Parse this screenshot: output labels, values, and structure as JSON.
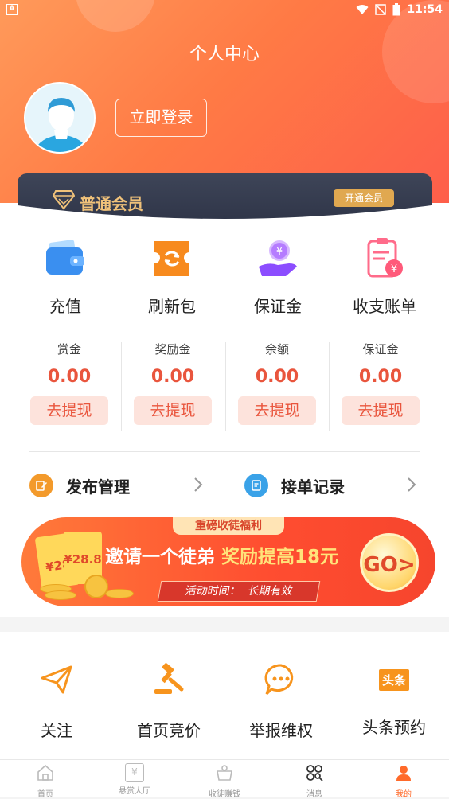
{
  "status_bar": {
    "time": "11:54",
    "app_badge": "A"
  },
  "header": {
    "title": "个人中心",
    "login_label": "立即登录"
  },
  "vip": {
    "level": "普通会员",
    "open_label": "开通会员"
  },
  "quick_actions": [
    {
      "label": "充值",
      "icon": "wallet-icon"
    },
    {
      "label": "刷新包",
      "icon": "refresh-ticket-icon"
    },
    {
      "label": "保证金",
      "icon": "deposit-hand-icon"
    },
    {
      "label": "收支账单",
      "icon": "bill-icon"
    }
  ],
  "balances": [
    {
      "title": "赏金",
      "value": "0.00",
      "action": "去提现"
    },
    {
      "title": "奖励金",
      "value": "0.00",
      "action": "去提现"
    },
    {
      "title": "余额",
      "value": "0.00",
      "action": "去提现"
    },
    {
      "title": "保证金",
      "value": "0.00",
      "action": "去提现"
    }
  ],
  "management": [
    {
      "label": "发布管理",
      "icon": "edit-icon",
      "color": "#f39a2b"
    },
    {
      "label": "接单记录",
      "icon": "record-icon",
      "color": "#3aa2e8"
    }
  ],
  "banner": {
    "tag": "重磅收徒福利",
    "text_prefix": "邀请一个徒弟 ",
    "text_highlight": "奖励提高18元",
    "go_label": "GO>",
    "time_label": "活动时间：",
    "time_value": "长期有效",
    "ticket1": "¥28.8",
    "ticket2": "¥28"
  },
  "tools": [
    {
      "label": "关注",
      "icon": "paper-plane-icon"
    },
    {
      "label": "首页竞价",
      "icon": "gavel-icon"
    },
    {
      "label": "举报维权",
      "icon": "chat-bubble-icon"
    },
    {
      "label": "头条预约",
      "icon": "headline-icon",
      "icon_text": "头条"
    }
  ],
  "tabs": [
    {
      "label": "首页",
      "icon": "home-icon"
    },
    {
      "label": "悬赏大厅",
      "icon": "reward-hall-icon",
      "icon_text": "¥"
    },
    {
      "label": "收徒赚钱",
      "icon": "apprentice-icon"
    },
    {
      "label": "消息",
      "icon": "message-icon"
    },
    {
      "label": "我的",
      "icon": "profile-icon"
    }
  ],
  "colors": {
    "accent": "#ff6a2a",
    "money": "#e9553d",
    "vip_gold": "#f0c27a"
  }
}
